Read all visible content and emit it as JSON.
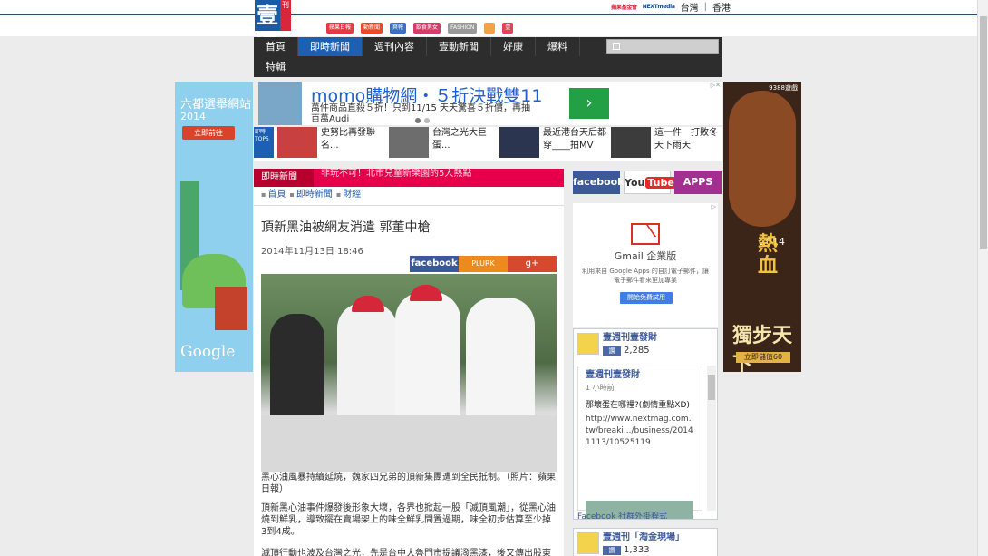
{
  "header": {
    "logo_text": "壹週",
    "logo_side": "刊",
    "toplinks": [
      "蘋果基金會",
      "NEXTmedia"
    ],
    "region_tw": "台灣",
    "region_hk": "香港",
    "brands": [
      "蘋果日報",
      "動新聞",
      "爽報",
      "飲食男女",
      "FASHION",
      "",
      "壹"
    ]
  },
  "nav": {
    "items": [
      "首頁",
      "即時新聞",
      "週刊內容",
      "壹動新聞",
      "好康",
      "爆料"
    ],
    "row2": [
      "特輯"
    ],
    "active": "即時新聞"
  },
  "left_ad": {
    "title": "六都選舉網站",
    "year": "2014",
    "button": "立即前往",
    "brand": "Google"
  },
  "right_ad": {
    "badge": "9388遊戲",
    "year": "2014",
    "title": "熱血",
    "big": "獨步天下",
    "cta": "立即儲值60"
  },
  "momo_ad": {
    "title": "momo購物網・５折決戰雙11",
    "desc": "萬件商品直殺５折！只到11/15 天天驚喜５折價，再抽百萬Audi",
    "go": "›"
  },
  "top_list": {
    "badge": "即時TOP5",
    "items": [
      {
        "text": "史努比再發聯名..."
      },
      {
        "text": "台灣之光大巨蛋..."
      },
      {
        "text": "最近港台天后都穿____拍MV"
      },
      {
        "text": "這一件　打敗冬天下雨天"
      }
    ]
  },
  "article": {
    "section_tag": "即時新聞",
    "ticker": "非玩不可！北市兒童新樂園的5大熱點",
    "crumbs": [
      "首頁",
      "即時新聞",
      "財經"
    ],
    "headline": "頂新黑油被網友消遣 郭董中槍",
    "date": "2014年11月13日 18:46",
    "share": {
      "facebook": "facebook",
      "plurk": "PLURK",
      "gplus": "g+"
    },
    "caption": "黑心油風暴持續延燒，魏家四兄弟的頂新集團遭到全民抵制。（照片：蘋果日報）",
    "para1": "頂新黑心油事件爆發後形象大壞，各界也掀起一股「滅頂風潮」，從黑心油燒到鮮乳，導致擺在賣場架上的味全鮮乳間置過期，味全初步估算至少掉3到4成。",
    "para2": "滅頂行動也波及台灣之光，先是台中大魯門市提議潑黑漆，後又傳出股東投資"
  },
  "social": {
    "facebook": "facebook",
    "youtube": "You",
    "youtube_tube": "Tube",
    "apps": "APPS"
  },
  "gmail_ad": {
    "title": "Gmail 企業版",
    "desc": "利用來自 Google Apps 的自訂電子郵件，讓電子郵件看來更加專業",
    "button": "開始免費試用"
  },
  "fb_widget": {
    "page_name": "壹週刊壹發財",
    "like_label": "讚",
    "likes": "2,285",
    "post_name": "壹週刊壹發財",
    "post_time": "1 小時前",
    "post_text": "那壞蛋在哪裡?(劇情重點XD)",
    "post_url": "http://www.nextmag.com.tw/breaki.../business/20141113/10525119",
    "footer": "Facebook 社群外掛程式"
  },
  "fb_widget2": {
    "page_name": "壹週刊「淘金現場」",
    "likes": "1,333"
  }
}
